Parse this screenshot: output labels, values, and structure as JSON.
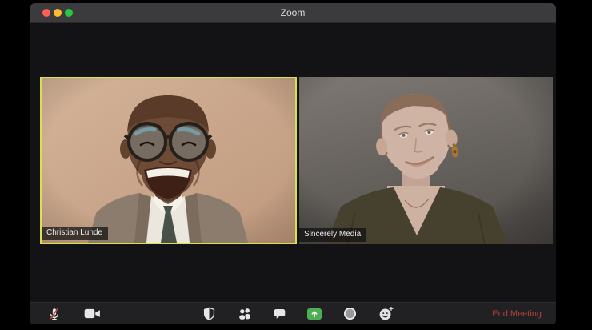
{
  "window": {
    "title": "Zoom",
    "traffic_lights": [
      {
        "name": "close",
        "color": "#ff5f57"
      },
      {
        "name": "minimize",
        "color": "#febc2e"
      },
      {
        "name": "zoom",
        "color": "#28c840"
      }
    ]
  },
  "participants": [
    {
      "name": "Christian Lunde",
      "active_speaker": true
    },
    {
      "name": "Sincerely Media",
      "active_speaker": false
    }
  ],
  "toolbar": {
    "buttons": [
      {
        "icon": "mic-muted-icon",
        "state": "muted"
      },
      {
        "icon": "video-camera-icon",
        "state": "on"
      },
      {
        "icon": "security-shield-icon"
      },
      {
        "icon": "participants-icon"
      },
      {
        "icon": "chat-icon"
      },
      {
        "icon": "share-screen-icon"
      },
      {
        "icon": "record-icon"
      },
      {
        "icon": "reactions-icon"
      }
    ],
    "end_meeting_label": "End Meeting"
  },
  "colors": {
    "active_speaker_border": "#d9e14f",
    "share_screen_green": "#4fae54",
    "end_meeting_red": "#b0413c",
    "mic_muted_slash": "#b4403b",
    "titlebar_bg": "#3b3b3d",
    "toolbar_bg": "#212124"
  }
}
